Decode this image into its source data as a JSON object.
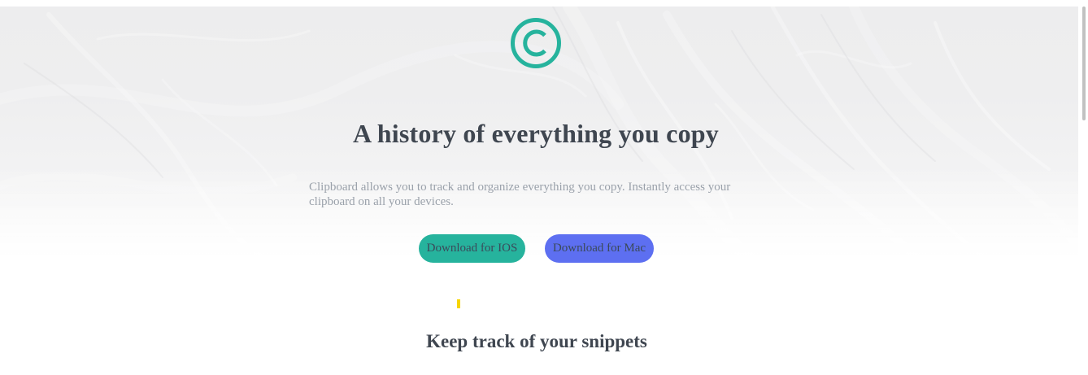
{
  "hero": {
    "logo_icon": "copyright-c-logo-icon",
    "logo_color": "#26b39d",
    "headline": "A history of everything you copy",
    "description": "Clipboard allows you to track and organize everything you copy. Instantly access your clipboard on all your devices.",
    "buttons": [
      {
        "label": "Download for IOS",
        "color": "#26b39d"
      },
      {
        "label": "Download for Mac",
        "color": "#5d6ff1"
      }
    ]
  },
  "features": {
    "accent_color": "#f7d500",
    "title": "Keep track of your snippets"
  }
}
